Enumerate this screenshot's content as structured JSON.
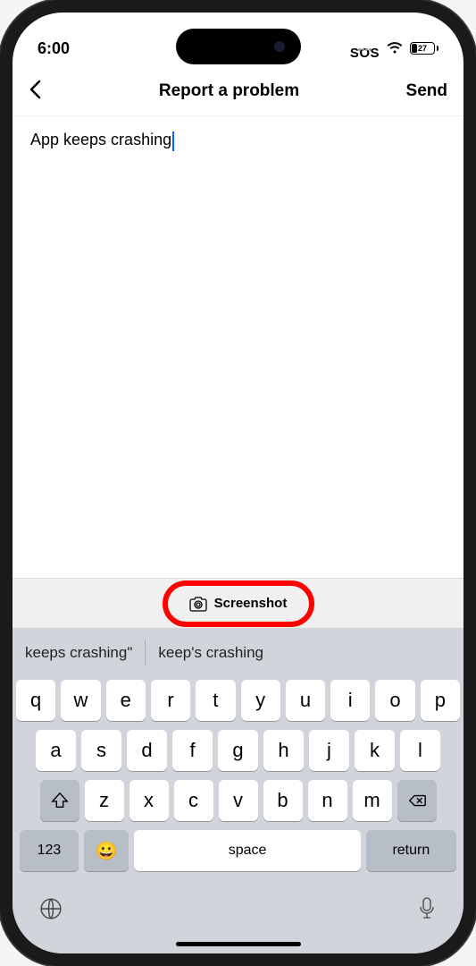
{
  "status_bar": {
    "time": "6:00",
    "sos": "SOS",
    "battery": "27"
  },
  "nav": {
    "title": "Report a problem",
    "send": "Send"
  },
  "input": {
    "text": "App keeps crashing"
  },
  "toolbar": {
    "screenshot": "Screenshot"
  },
  "suggestions": [
    "keeps crashing\"",
    "keep's crashing"
  ],
  "keyboard": {
    "row1": [
      "q",
      "w",
      "e",
      "r",
      "t",
      "y",
      "u",
      "i",
      "o",
      "p"
    ],
    "row2": [
      "a",
      "s",
      "d",
      "f",
      "g",
      "h",
      "j",
      "k",
      "l"
    ],
    "row3": [
      "z",
      "x",
      "c",
      "v",
      "b",
      "n",
      "m"
    ],
    "numbers": "123",
    "space": "space",
    "return": "return"
  }
}
